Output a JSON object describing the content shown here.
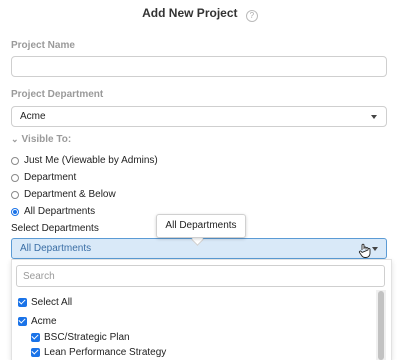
{
  "header": {
    "title": "Add New Project",
    "help_icon": "question-circle-icon"
  },
  "project_name": {
    "label": "Project Name",
    "value": "",
    "placeholder": ""
  },
  "project_department": {
    "label": "Project Department",
    "selected": "Acme"
  },
  "visible_to": {
    "label": "Visible To:",
    "options": [
      {
        "label": "Just Me (Viewable by Admins)",
        "selected": false
      },
      {
        "label": "Department",
        "selected": false
      },
      {
        "label": "Department & Below",
        "selected": false
      },
      {
        "label": "All Departments",
        "selected": true
      }
    ]
  },
  "select_departments": {
    "label": "Select Departments",
    "selected": "All Departments",
    "tooltip": "All Departments"
  },
  "dropdown": {
    "search_placeholder": "Search",
    "items": [
      {
        "label": "Select All",
        "checked": true,
        "level": 0
      },
      {
        "label": "Acme",
        "checked": true,
        "level": 0
      },
      {
        "label": "BSC/Strategic Plan",
        "checked": true,
        "level": 1
      },
      {
        "label": "Lean Performance Strategy",
        "checked": true,
        "level": 1
      }
    ]
  },
  "colors": {
    "accent": "#1a73e8",
    "active_select_bg": "#d9e9f8",
    "muted_label": "#9a9a9a"
  }
}
